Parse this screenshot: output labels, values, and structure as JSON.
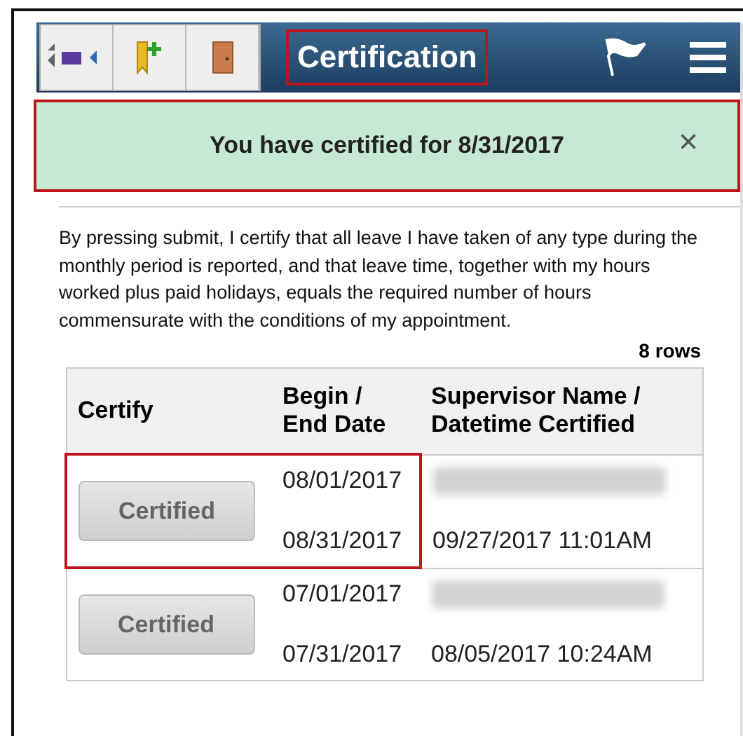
{
  "header": {
    "title": "Certification",
    "title_highlighted": true
  },
  "notification": {
    "message": "You have certified for 8/31/2017",
    "close": "×",
    "highlighted": true
  },
  "statement": "By pressing submit, I certify that all leave I have taken of any type during the monthly period is reported, and that leave time, together with my hours worked plus paid holidays, equals the required number of hours commensurate with the conditions of my appointment.",
  "row_count": "8 rows",
  "table": {
    "columns": [
      "Certify",
      "Begin / End Date",
      "Supervisor Name / Datetime Certified"
    ],
    "rows": [
      {
        "button": "Certified",
        "disabled": true,
        "begin": "08/01/2017",
        "end": "08/31/2017",
        "certified": "09/27/2017 11:01AM",
        "highlighted": true
      },
      {
        "button": "Certified",
        "disabled": true,
        "begin": "07/01/2017",
        "end": "07/31/2017",
        "certified": "08/05/2017 10:24AM",
        "highlighted": false
      }
    ]
  }
}
